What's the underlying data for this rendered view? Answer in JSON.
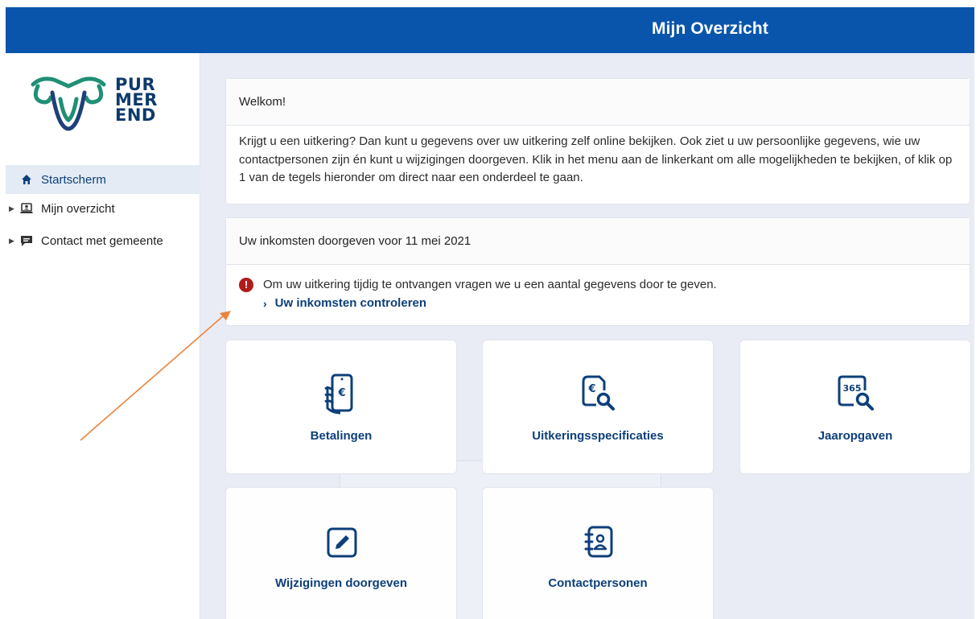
{
  "header": {
    "title": "Mijn Overzicht"
  },
  "logo": {
    "line1": "PUR",
    "line2": "MER",
    "line3": "END"
  },
  "sidebar": {
    "items": [
      {
        "label": "Startscherm",
        "icon": "home-icon",
        "active": true
      },
      {
        "label": "Mijn overzicht",
        "icon": "user-card-icon",
        "active": false
      },
      {
        "label": "Contact met gemeente",
        "icon": "chat-icon",
        "active": false
      }
    ]
  },
  "welcome": {
    "title": "Welkom!",
    "text": "Krijgt u een uitkering? Dan kunt u gegevens over uw uitkering zelf online bekijken. Ook ziet u uw persoonlijke gegevens, wie uw contactpersonen zijn én kunt u wijzigingen doorgeven. Klik in het menu aan de linkerkant om alle mogelijkheden te bekijken, of klik op 1 van de tegels hieronder om direct naar een onderdeel te gaan."
  },
  "income": {
    "title": "Uw inkomsten doorgeven voor 11 mei 2021",
    "message": "Om uw uitkering tijdig te ontvangen vragen we u een aantal gegevens door te geven.",
    "link_label": "Uw inkomsten controleren"
  },
  "tiles": [
    {
      "label": "Betalingen",
      "icon": "phone-payment-icon"
    },
    {
      "label": "Uitkeringsspecificaties",
      "icon": "euro-document-search-icon"
    },
    {
      "label": "Jaaropgaven",
      "icon": "calendar-365-search-icon",
      "badge": "365"
    },
    {
      "label": "Wijzigingen doorgeven",
      "icon": "edit-pencil-icon"
    },
    {
      "label": "Contactpersonen",
      "icon": "contact-book-icon"
    }
  ],
  "colors": {
    "brand_blue": "#0a55ac",
    "link_blue": "#0d3f7a",
    "alert_red": "#b01c1c",
    "annotation_orange": "#e8843e"
  }
}
